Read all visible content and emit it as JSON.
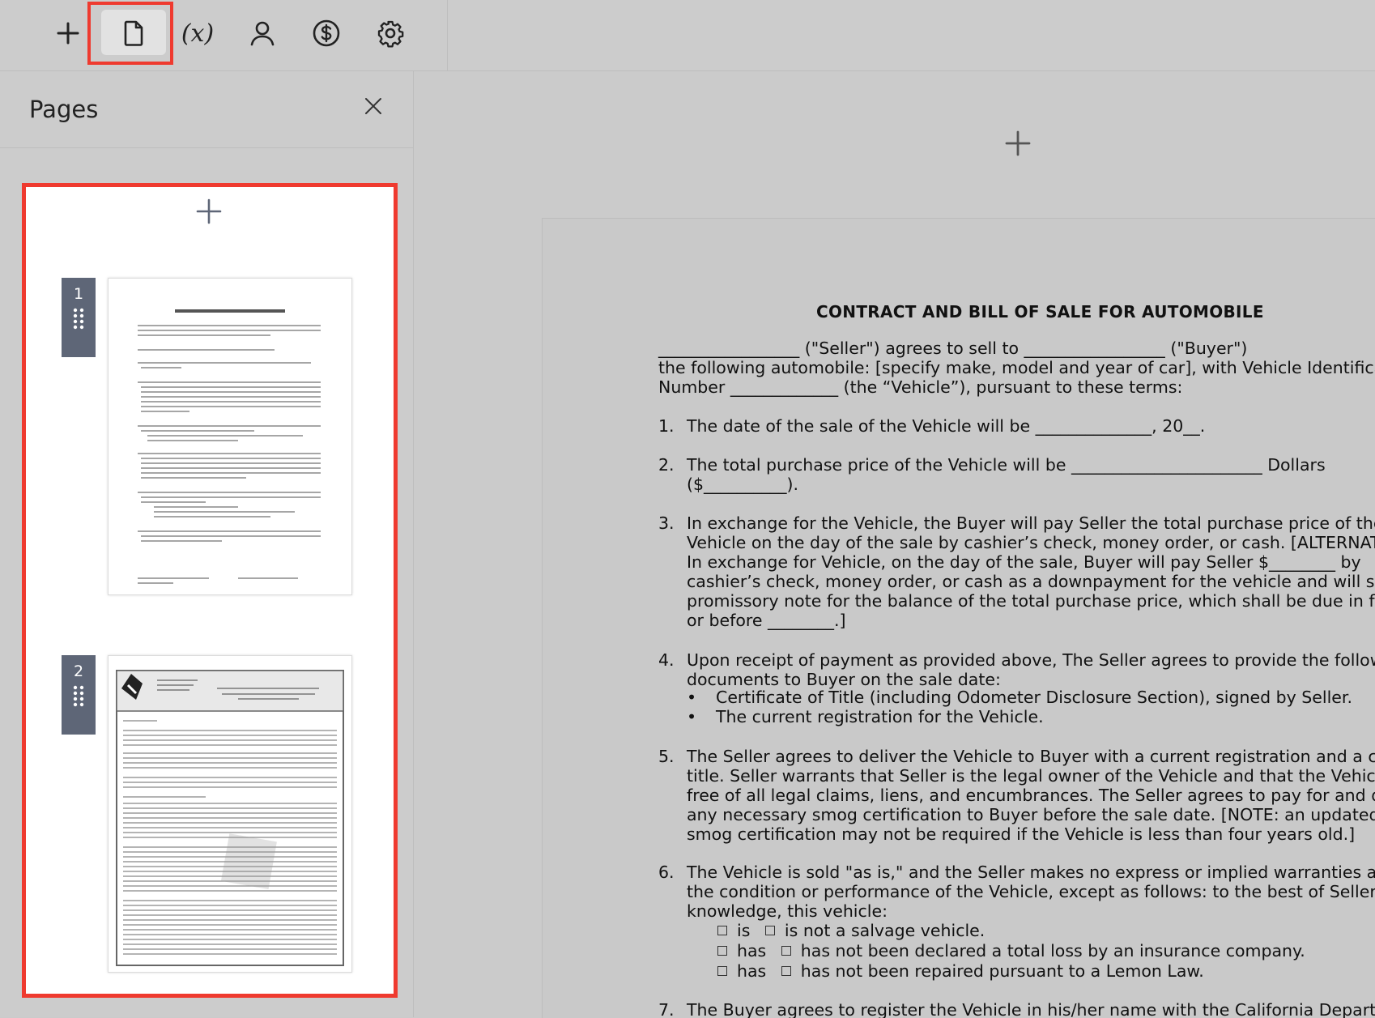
{
  "toolbar": {
    "items": [
      {
        "name": "add",
        "icon": "plus-icon"
      },
      {
        "name": "pages",
        "icon": "file-icon",
        "active": true
      },
      {
        "name": "variables",
        "icon": "variable-icon",
        "label": "(x)"
      },
      {
        "name": "recipients",
        "icon": "user-icon"
      },
      {
        "name": "pricing",
        "icon": "dollar-circle-icon"
      },
      {
        "name": "settings",
        "icon": "gear-icon"
      }
    ],
    "variables_label": "(x)"
  },
  "sidebar": {
    "title": "Pages",
    "pages": [
      {
        "number": "1"
      },
      {
        "number": "2"
      }
    ]
  },
  "colors": {
    "highlight": "#ef3a2f",
    "badge": "#5e6677",
    "background": "#cbcbcb"
  },
  "document": {
    "title": "CONTRACT AND BILL OF SALE FOR AUTOMOBILE",
    "intro_lines": [
      "_________________ (\"Seller\") agrees to sell to _________________ (\"Buyer\")",
      "the following automobile: [specify make, model and year of car], with Vehicle Identifica",
      "Number _____________ (the “Vehicle”), pursuant to these terms:"
    ],
    "items": [
      {
        "num": "1.",
        "lines": [
          "The date of the sale of the Vehicle will be ______________, 20__."
        ]
      },
      {
        "num": "2.",
        "lines": [
          "The total purchase price of the Vehicle will be _______________________ Dollars",
          "($__________)."
        ]
      },
      {
        "num": "3.",
        "lines": [
          "In exchange for the Vehicle, the Buyer will pay Seller the total purchase price of the",
          "Vehicle on the day of the sale by cashier’s check, money order, or cash. [ALTERNATI",
          "In exchange for Vehicle, on the day of the sale, Buyer will pay Seller $________ by",
          "cashier’s check, money order, or cash as a downpayment for the vehicle and will sig",
          "promissory note for the balance of the total purchase price, which shall be due in ful",
          "or before ________.]"
        ]
      },
      {
        "num": "4.",
        "lines": [
          "Upon receipt of payment as provided above, The Seller agrees to provide the followi",
          "documents to Buyer on the sale date:"
        ]
      },
      {
        "num": "5.",
        "lines": [
          "The Seller agrees to deliver the Vehicle to Buyer with a current registration and a cle",
          "title.  Seller warrants that Seller is the legal owner of the Vehicle and that the Vehicl",
          "free of all legal claims, liens, and encumbrances. The Seller agrees to pay for and de",
          "any necessary smog certification to Buyer before the sale date.  [NOTE: an updated",
          "smog certification may not be required if the Vehicle is less than four years old.]"
        ]
      },
      {
        "num": "6.",
        "lines": [
          "The Vehicle is sold \"as is,\" and the Seller makes no express or implied warranties as",
          "the condition or performance of the Vehicle, except as follows: to the best of Seller's",
          "knowledge, this vehicle:"
        ]
      },
      {
        "num": "7.",
        "lines": [
          "The Buyer agrees to register the Vehicle in his/her name with the California Departm"
        ]
      }
    ],
    "bullets": [
      "Certificate of Title (including Odometer Disclosure Section), signed by Seller.",
      "The current registration for the Vehicle."
    ],
    "bullet_glyph": "•",
    "checkbox_rows": [
      {
        "a": "is",
        "b": "is not a salvage vehicle."
      },
      {
        "a": "has",
        "b": "has not been declared a total loss by an insurance company."
      },
      {
        "a": "has",
        "b": "has not been repaired pursuant to a Lemon Law."
      }
    ]
  }
}
